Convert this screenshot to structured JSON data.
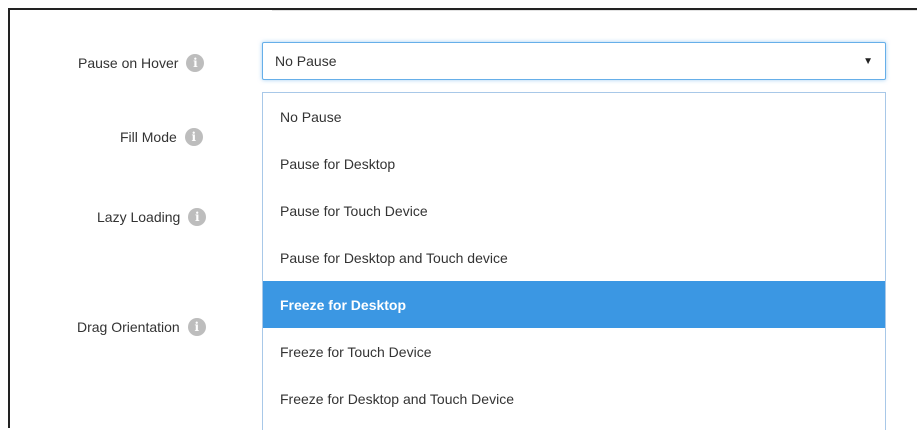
{
  "labels": {
    "pause_on_hover": "Pause on Hover",
    "fill_mode": "Fill Mode",
    "lazy_loading": "Lazy Loading",
    "drag_orientation": "Drag Orientation"
  },
  "info_icon_glyph": "i",
  "select": {
    "value": "No Pause",
    "caret": "▼"
  },
  "dropdown": {
    "options": [
      "No Pause",
      "Pause for Desktop",
      "Pause for Touch Device",
      "Pause for Desktop and Touch device",
      "Freeze for Desktop",
      "Freeze for Touch Device",
      "Freeze for Desktop and Touch Device"
    ],
    "highlighted": "Freeze for Desktop"
  },
  "colors": {
    "highlight": "#3b97e3",
    "focus_border": "#66afe9",
    "icon": "#bdbdbd"
  }
}
